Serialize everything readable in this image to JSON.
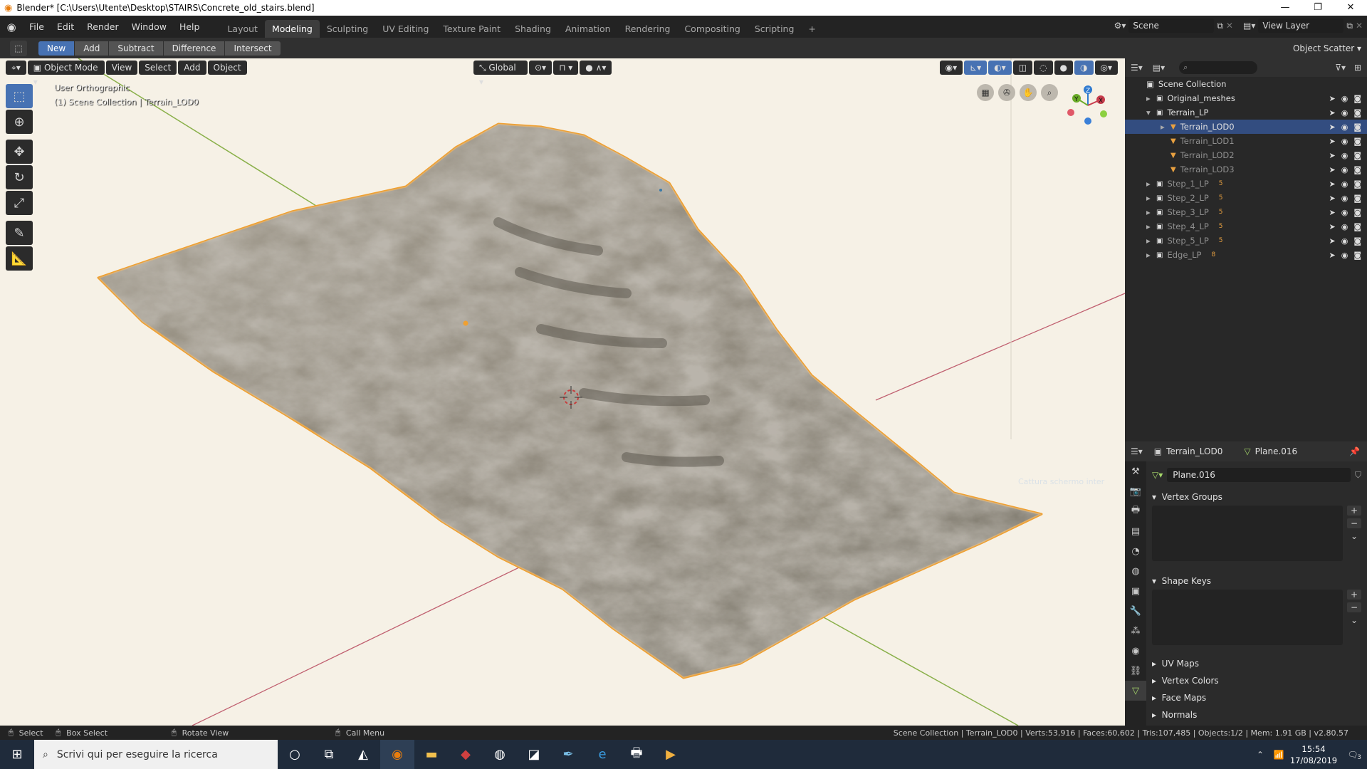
{
  "title_bar": {
    "text": "Blender* [C:\\Users\\Utente\\Desktop\\STAIRS\\Concrete_old_stairs.blend]",
    "minimize": "—",
    "maximize": "❐",
    "close": "✕"
  },
  "menu": {
    "items": [
      "File",
      "Edit",
      "Render",
      "Window",
      "Help"
    ]
  },
  "workspaces": {
    "tabs": [
      "Layout",
      "Modeling",
      "Sculpting",
      "UV Editing",
      "Texture Paint",
      "Shading",
      "Animation",
      "Rendering",
      "Compositing",
      "Scripting"
    ],
    "active": "Modeling",
    "add": "+"
  },
  "scene": {
    "label": "Scene",
    "view_layer": "View Layer"
  },
  "tool_header": {
    "buttons": [
      "New",
      "Add",
      "Subtract",
      "Difference",
      "Intersect"
    ],
    "active": "New",
    "right": "Object Scatter"
  },
  "viewport_header": {
    "mode": "Object Mode",
    "view": "View",
    "select": "Select",
    "add": "Add",
    "object": "Object",
    "orientation": "Global"
  },
  "viewport": {
    "view_name": "User Orthographic",
    "collection_info": "(1) Scene Collection | Terrain_LOD0",
    "tooltip": "Cattura schermo inter"
  },
  "outliner": {
    "root": "Scene Collection",
    "rows": [
      {
        "name": "Original_meshes",
        "badge": "",
        "selected": false,
        "dim": false,
        "indent": 1,
        "expand": "▸",
        "type": "collection"
      },
      {
        "name": "Terrain_LP",
        "badge": "",
        "selected": false,
        "dim": false,
        "indent": 1,
        "expand": "▾",
        "type": "collection"
      },
      {
        "name": "Terrain_LOD0",
        "badge": "",
        "selected": true,
        "dim": false,
        "indent": 2,
        "expand": "▸",
        "type": "mesh"
      },
      {
        "name": "Terrain_LOD1",
        "badge": "",
        "selected": false,
        "dim": true,
        "indent": 2,
        "expand": "",
        "type": "mesh"
      },
      {
        "name": "Terrain_LOD2",
        "badge": "",
        "selected": false,
        "dim": true,
        "indent": 2,
        "expand": "",
        "type": "mesh"
      },
      {
        "name": "Terrain_LOD3",
        "badge": "",
        "selected": false,
        "dim": true,
        "indent": 2,
        "expand": "",
        "type": "mesh"
      },
      {
        "name": "Step_1_LP",
        "badge": "5",
        "selected": false,
        "dim": true,
        "indent": 1,
        "expand": "▸",
        "type": "collection"
      },
      {
        "name": "Step_2_LP",
        "badge": "5",
        "selected": false,
        "dim": true,
        "indent": 1,
        "expand": "▸",
        "type": "collection"
      },
      {
        "name": "Step_3_LP",
        "badge": "5",
        "selected": false,
        "dim": true,
        "indent": 1,
        "expand": "▸",
        "type": "collection"
      },
      {
        "name": "Step_4_LP",
        "badge": "5",
        "selected": false,
        "dim": true,
        "indent": 1,
        "expand": "▸",
        "type": "collection"
      },
      {
        "name": "Step_5_LP",
        "badge": "5",
        "selected": false,
        "dim": true,
        "indent": 1,
        "expand": "▸",
        "type": "collection"
      },
      {
        "name": "Edge_LP",
        "badge": "8",
        "selected": false,
        "dim": true,
        "indent": 1,
        "expand": "▸",
        "type": "collection"
      }
    ]
  },
  "properties": {
    "object": "Terrain_LOD0",
    "mesh": "Plane.016",
    "data_name": "Plane.016",
    "panels": {
      "vertex_groups": "Vertex Groups",
      "shape_keys": "Shape Keys",
      "uv_maps": "UV Maps",
      "vertex_colors": "Vertex Colors",
      "face_maps": "Face Maps",
      "normals": "Normals"
    }
  },
  "status_bar": {
    "select": "Select",
    "box_select": "Box Select",
    "rotate_view": "Rotate View",
    "call_menu": "Call Menu",
    "stats": "Scene Collection | Terrain_LOD0 | Verts:53,916 | Faces:60,602 | Tris:107,485 | Objects:1/2 | Mem: 1.91 GB | v2.80.57"
  },
  "taskbar": {
    "search_placeholder": "Scrivi qui per eseguire la ricerca",
    "time": "15:54",
    "date": "17/08/2019",
    "notifications": "3"
  },
  "colors": {
    "accent": "#4772b3",
    "selection": "#334d80",
    "viewport_bg": "#f6f1e6",
    "object_outline": "#f0a030"
  }
}
